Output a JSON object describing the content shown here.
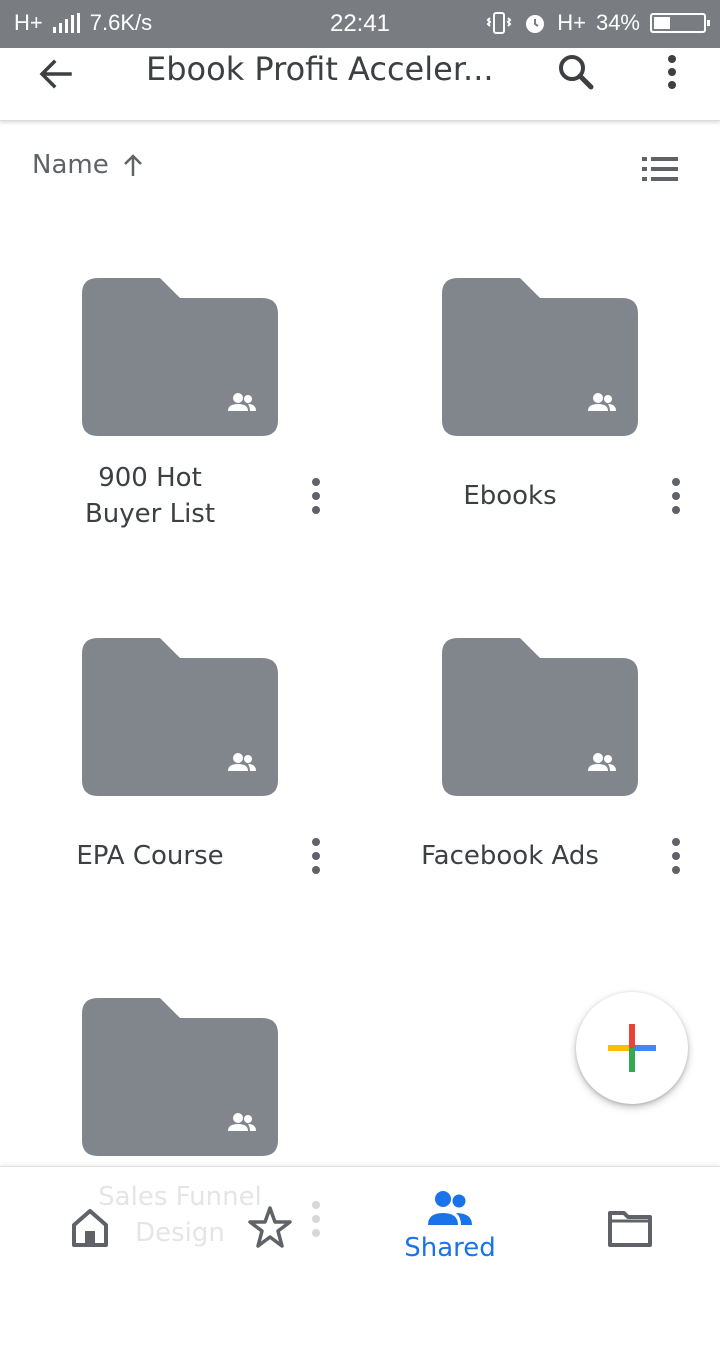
{
  "status_bar": {
    "network_type": "H+",
    "data_speed": "7.6K/s",
    "time": "22:41",
    "network_type_2": "H+",
    "battery_percent": "34%",
    "battery_level": 0.34
  },
  "app_bar": {
    "title": "Ebook Profit Acceler..."
  },
  "sort": {
    "label": "Name"
  },
  "folders": [
    {
      "name_line1": "900 Hot",
      "name_line2": "Buyer List"
    },
    {
      "name": "Ebooks"
    },
    {
      "name": "EPA Course"
    },
    {
      "name": "Facebook Ads"
    },
    {
      "name_line1": "Sales Funnel",
      "name_line2": "Design"
    }
  ],
  "bottom_nav": {
    "shared_label": "Shared"
  },
  "colors": {
    "folder": "#80868b",
    "accent": "#1a73e8",
    "status_bar": "#797c80"
  }
}
